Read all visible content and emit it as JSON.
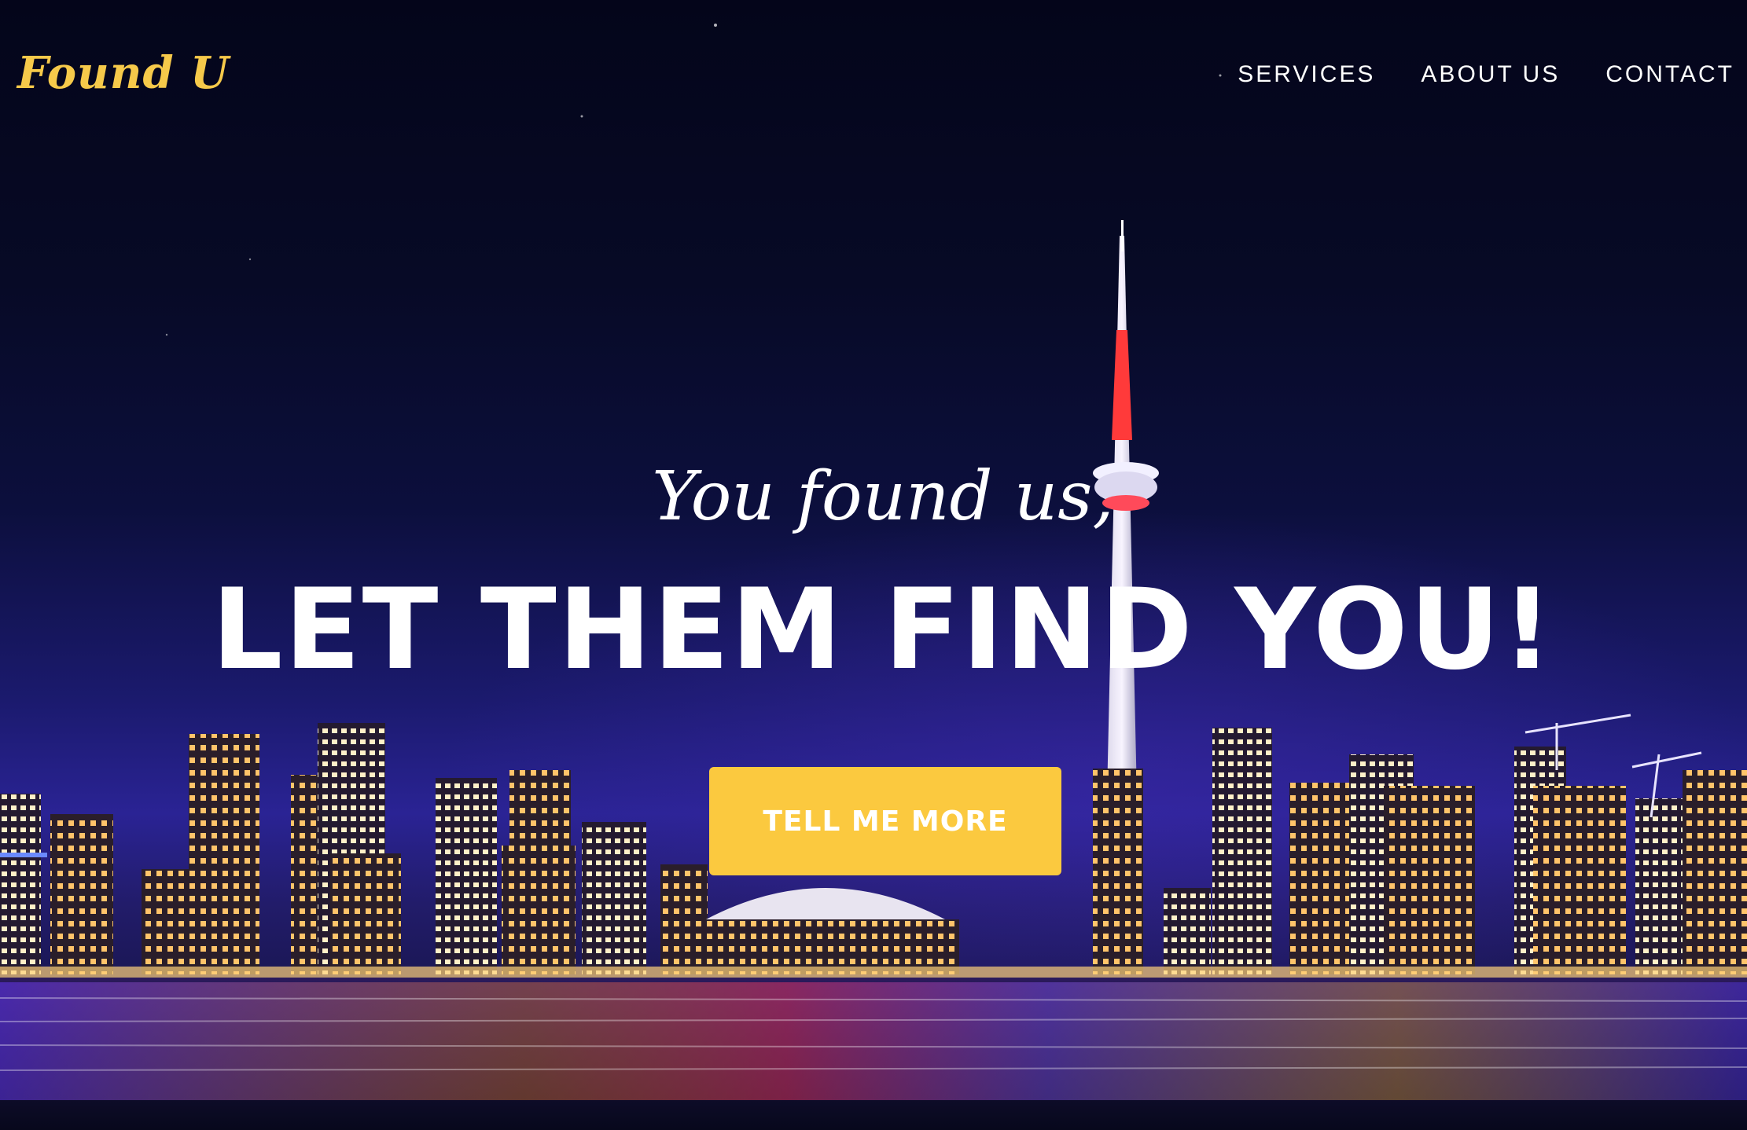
{
  "brand": {
    "logo_text": "Found U",
    "accent_color": "#fbc93f"
  },
  "nav": {
    "items": [
      {
        "label": "SERVICES"
      },
      {
        "label": "ABOUT US"
      },
      {
        "label": "CONTACT"
      }
    ]
  },
  "hero": {
    "intro": "You found us,",
    "headline": "LET THEM FIND YOU!",
    "cta_label": "TELL ME MORE"
  }
}
